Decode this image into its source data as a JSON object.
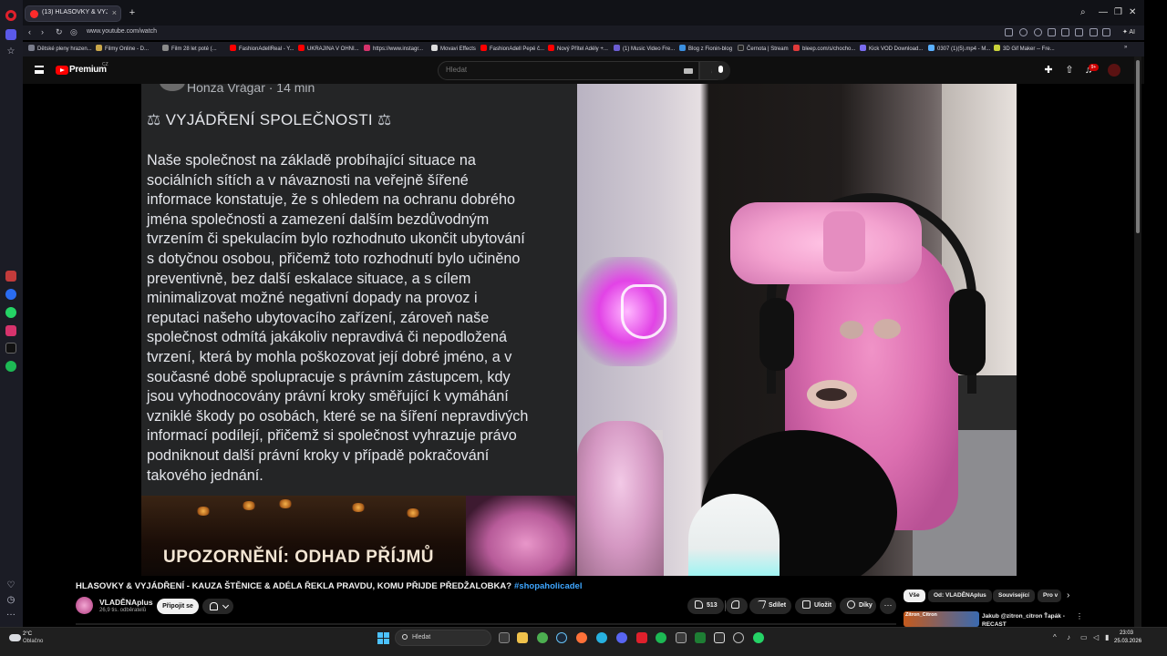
{
  "browser": {
    "tab_title": "(13) HLASOVKY & VYJ",
    "url": "www.youtube.com/watch",
    "ai_label": "AI",
    "bookmarks": [
      "Dětské pleny hrazen...",
      "Filmy Online - D...",
      "Film 28 let poté (...",
      "FashionAdellReal - Y...",
      "UKRAJINA V OHNI...",
      "https://www.instagr...",
      "Movavi Effects",
      "FashionAdell Pepé č...",
      "Nový Přítel Adély +...",
      "(1) Music Video Fre...",
      "Blog z Fionin-blog",
      "Černota | Stream",
      "bleep.com/s/chocho...",
      "Kick VOD Download...",
      "0307 (1)(5).mp4 - M...",
      "3D Gif Maker -- Fre..."
    ]
  },
  "youtube": {
    "brand": "Premium",
    "country": "CZ",
    "search_placeholder": "Hledat",
    "notification_count": "9+"
  },
  "video_frame": {
    "post_author": "Honza Vrágar · 14 min",
    "post_heading": "VYJÁDŘENÍ SPOLEČNOSTI",
    "post_lines": [
      "Naše společnost na základě probíhající situace na",
      "sociálních sítích a v návaznosti na veřejně šířené",
      "informace konstatuje, že s ohledem na ochranu dobrého",
      "jména společnosti a zamezení dalším bezdůvodným",
      "tvrzením či spekulacím bylo rozhodnuto ukončit ubytování",
      "s dotyčnou osobou, přičemž toto rozhodnutí bylo učiněno",
      "preventivně, bez další eskalace situace, a s cílem",
      "minimalizovat možné negativní dopady na provoz i",
      "reputaci našeho ubytovacího zařízení, zároveň naše",
      "společnost odmítá jakákoliv nepravdivá či nepodložená",
      "tvrzení, která by mohla poškozovat její dobré jméno, a v",
      "současné době spolupracuje s právním zástupcem, kdy",
      "jsou vyhodnocovány právní kroky směřující k vymáhání",
      "vzniklé škody po osobách, které se na šíření nepravdivých",
      "informací podílejí, přičemž si společnost vyhrazuje právo",
      "podniknout další právní kroky v případě pokračování",
      "takového jednání."
    ],
    "promo_text": "UPOZORNĚNÍ: ODHAD PŘÍJMŮ"
  },
  "video": {
    "title": "HLASOVKY & VYJÁDŘENÍ - KAUZA ŠTĚNICE & ADÉLA ŘEKLA PRAVDU, KOMU PŘIJDE PŘEDŽALOBKA?",
    "hashtag": "#shopaholicadel",
    "channel_name": "VLADĚNAplus",
    "subscribers": "26,9 tis. odběratelů",
    "join_label": "Připojit se",
    "likes": "513",
    "share_label": "Sdílet",
    "save_label": "Uložit",
    "thanks_label": "Díky"
  },
  "recommendations": {
    "chips": [
      "Vše",
      "Od: VLADĚNAplus",
      "Související",
      "Pro v"
    ],
    "first_title": "Jakub @zitron_citron Ťapák - RECAST",
    "first_thumb_text": "Zitron_Citron"
  },
  "taskbar": {
    "temperature": "2°C",
    "weather": "Oblačno",
    "search_placeholder": "Hledat",
    "time": "23:03",
    "date": "25.03.2026"
  },
  "colors": {
    "youtube_red": "#ff0000",
    "link_blue": "#3ea6ff",
    "opera_red": "#e0202c"
  }
}
